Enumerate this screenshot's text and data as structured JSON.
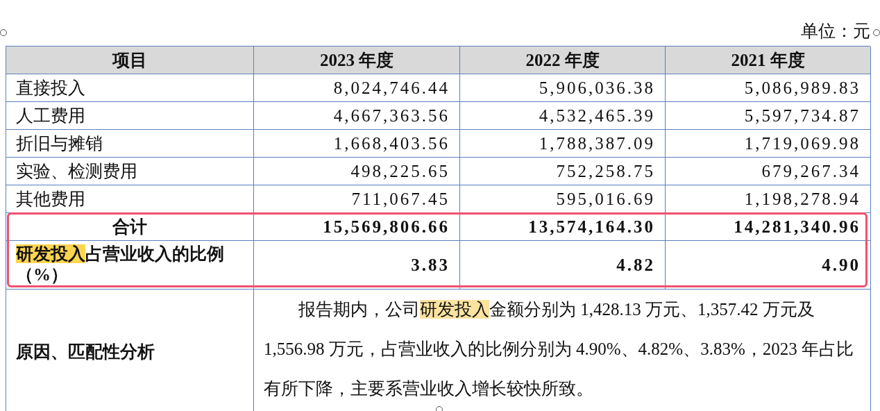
{
  "unit": "单位：元",
  "columns": [
    "项目",
    "2023 年度",
    "2022 年度",
    "2021 年度"
  ],
  "rows": [
    {
      "kind": "normal",
      "label": [
        {
          "text": "直接投入",
          "highlighted": false
        }
      ],
      "values": [
        "8,024,746.44",
        "5,906,036.38",
        "5,086,989.83"
      ]
    },
    {
      "kind": "normal",
      "label": [
        {
          "text": "人工费用",
          "highlighted": false
        }
      ],
      "values": [
        "4,667,363.56",
        "4,532,465.39",
        "5,597,734.87"
      ]
    },
    {
      "kind": "normal",
      "label": [
        {
          "text": "折旧与摊销",
          "highlighted": false
        }
      ],
      "values": [
        "1,668,403.56",
        "1,788,387.09",
        "1,719,069.98"
      ]
    },
    {
      "kind": "normal",
      "label": [
        {
          "text": "实验、检测费用",
          "highlighted": false
        }
      ],
      "values": [
        "498,225.65",
        "752,258.75",
        "679,267.34"
      ]
    },
    {
      "kind": "normal",
      "label": [
        {
          "text": "其他费用",
          "highlighted": false
        }
      ],
      "values": [
        "711,067.45",
        "595,016.69",
        "1,198,278.94"
      ]
    },
    {
      "kind": "total",
      "label": [
        {
          "text": "合计",
          "highlighted": false
        }
      ],
      "values": [
        "15,569,806.66",
        "13,574,164.30",
        "14,281,340.96"
      ]
    },
    {
      "kind": "ratio",
      "label": [
        {
          "text": "研发投入",
          "highlighted": true
        },
        {
          "text": "占营业收入的比例（%）",
          "highlighted": false
        }
      ],
      "values": [
        "3.83",
        "4.82",
        "4.90"
      ]
    }
  ],
  "analysis": {
    "label": "原因、匹配性分析",
    "text": [
      {
        "text": "报告期内，公司",
        "highlighted": false
      },
      {
        "text": "研发投入",
        "highlighted": true
      },
      {
        "text": "金额分别为 1,428.13 万元、1,357.42 万元及 1,556.98 万元，占营业收入的比例分别为 4.90%、4.82%、3.83%，2023 年占比有所下降，主要系营业收入增长较快所致。",
        "highlighted": false
      }
    ]
  }
}
